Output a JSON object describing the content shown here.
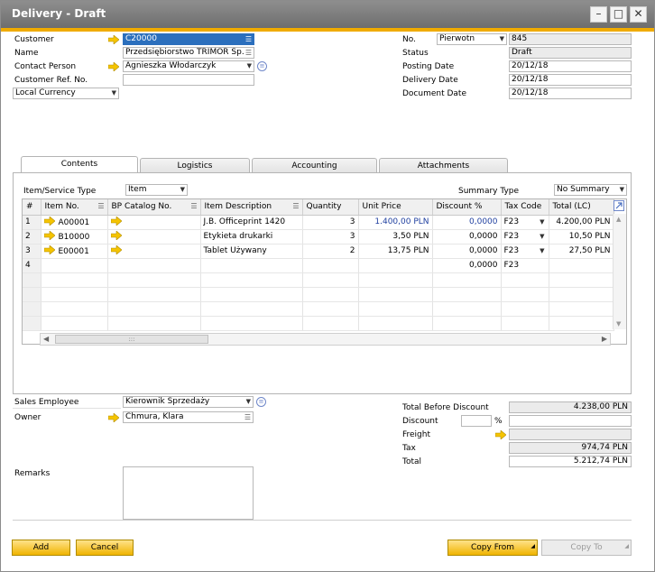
{
  "window": {
    "title": "Delivery - Draft"
  },
  "header": {
    "customer_label": "Customer",
    "customer_value": "C20000",
    "name_label": "Name",
    "name_value": "Przedsiębiorstwo TRIMOR Sp.",
    "contact_label": "Contact Person",
    "contact_value": "Agnieszka Włodarczyk",
    "ref_label": "Customer Ref. No.",
    "ref_value": "",
    "currency_value": "Local Currency",
    "no_label": "No.",
    "no_series": "Pierwotn",
    "no_value": "845",
    "status_label": "Status",
    "status_value": "Draft",
    "posting_label": "Posting Date",
    "posting_value": "20/12/18",
    "delivery_label": "Delivery Date",
    "delivery_value": "20/12/18",
    "document_label": "Document Date",
    "document_value": "20/12/18"
  },
  "tabs": [
    "Contents",
    "Logistics",
    "Accounting",
    "Attachments"
  ],
  "contents": {
    "item_type_label": "Item/Service Type",
    "item_type_value": "Item",
    "summary_label": "Summary Type",
    "summary_value": "No Summary",
    "columns": [
      "#",
      "Item No.",
      "BP Catalog No.",
      "Item Description",
      "Quantity",
      "Unit Price",
      "Discount %",
      "Tax Code",
      "Total (LC)"
    ],
    "rows": [
      {
        "n": "1",
        "item": "A00001",
        "desc": "J.B. Officeprint 1420",
        "qty": "3",
        "price": "1.400,00 PLN",
        "disc": "0,0000",
        "tax": "F23",
        "total": "4.200,00 PLN"
      },
      {
        "n": "2",
        "item": "B10000",
        "desc": "Etykieta drukarki",
        "qty": "3",
        "price": "3,50 PLN",
        "disc": "0,0000",
        "tax": "F23",
        "total": "10,50 PLN"
      },
      {
        "n": "3",
        "item": "E00001",
        "desc": "Tablet Używany",
        "qty": "2",
        "price": "13,75 PLN",
        "disc": "0,0000",
        "tax": "F23",
        "total": "27,50 PLN"
      },
      {
        "n": "4",
        "item": "",
        "desc": "",
        "qty": "",
        "price": "",
        "disc": "0,0000",
        "tax": "F23",
        "total": ""
      }
    ]
  },
  "footer": {
    "sales_emp_label": "Sales Employee",
    "sales_emp_value": "Kierownik Sprzedaży",
    "owner_label": "Owner",
    "owner_value": "Chmura, Klara",
    "remarks_label": "Remarks",
    "tbd_label": "Total Before Discount",
    "tbd_value": "4.238,00 PLN",
    "discount_label": "Discount",
    "percent": "%",
    "freight_label": "Freight",
    "tax_label": "Tax",
    "tax_value": "974,74 PLN",
    "total_label": "Total",
    "total_value": "5.212,74 PLN"
  },
  "buttons": {
    "add": "Add",
    "cancel": "Cancel",
    "copy_from": "Copy From",
    "copy_to": "Copy To"
  },
  "colors": {
    "accent": "#f0ab00",
    "selection": "#2b6fbd",
    "arrow": "#f5c400"
  }
}
